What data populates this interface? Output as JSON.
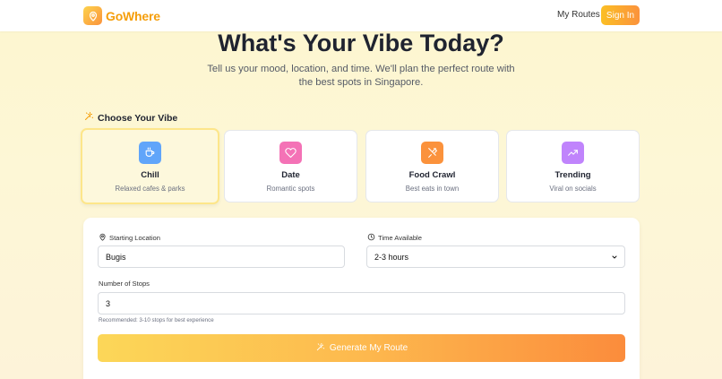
{
  "header": {
    "brand": "GoWhere",
    "nav_my_routes": "My Routes",
    "sign_in": "Sign In"
  },
  "hero": {
    "title": "What's Your Vibe Today?",
    "subtitle": "Tell us your mood, location, and time. We'll plan the perfect route with the best spots in Singapore."
  },
  "vibe_section": {
    "label": "Choose Your Vibe",
    "selected": "Chill",
    "options": [
      {
        "title": "Chill",
        "desc": "Relaxed cafes & parks",
        "icon": "coffee-icon",
        "color": "#60a5fa"
      },
      {
        "title": "Date",
        "desc": "Romantic spots",
        "icon": "heart-icon",
        "color": "#f472b6"
      },
      {
        "title": "Food Crawl",
        "desc": "Best eats in town",
        "icon": "utensils-icon",
        "color": "#fb923c"
      },
      {
        "title": "Trending",
        "desc": "Viral on socials",
        "icon": "trending-up-icon",
        "color": "#c084fc"
      }
    ]
  },
  "form": {
    "starting_location_label": "Starting Location",
    "starting_location_value": "Bugis",
    "time_available_label": "Time Available",
    "time_available_value": "2-3 hours",
    "stops_label": "Number of Stops",
    "stops_value": "3",
    "stops_hint": "Recommended: 3-10 stops for best experience",
    "generate_label": "Generate My Route"
  },
  "colors": {
    "accent": "#f59e0b",
    "accent_orange": "#fb923c",
    "background": "#fdf6cf"
  }
}
